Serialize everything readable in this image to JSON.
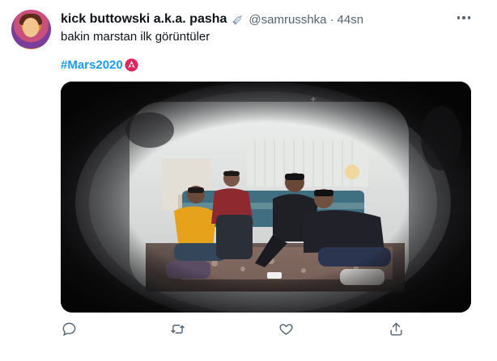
{
  "tweet": {
    "display_name": "kick buttowski a.k.a. pasha",
    "name_emoji": "syringe-icon",
    "handle": "@samrusshka",
    "separator": "·",
    "time": "44sn",
    "text": "bakin marstan ilk görüntüler",
    "hashtag": "#Mars2020",
    "hashtag_emoji": "mars-rover-badge-icon"
  },
  "media": {
    "type": "video-still",
    "description_icon": "video-icon"
  },
  "actions": [
    "reply-icon",
    "retweet-icon",
    "like-icon",
    "share-icon"
  ],
  "colors": {
    "link": "#1d9bf0",
    "secondary_text": "#536471",
    "primary_text": "#0f1419",
    "hashtag_badge": "#e0245e"
  }
}
